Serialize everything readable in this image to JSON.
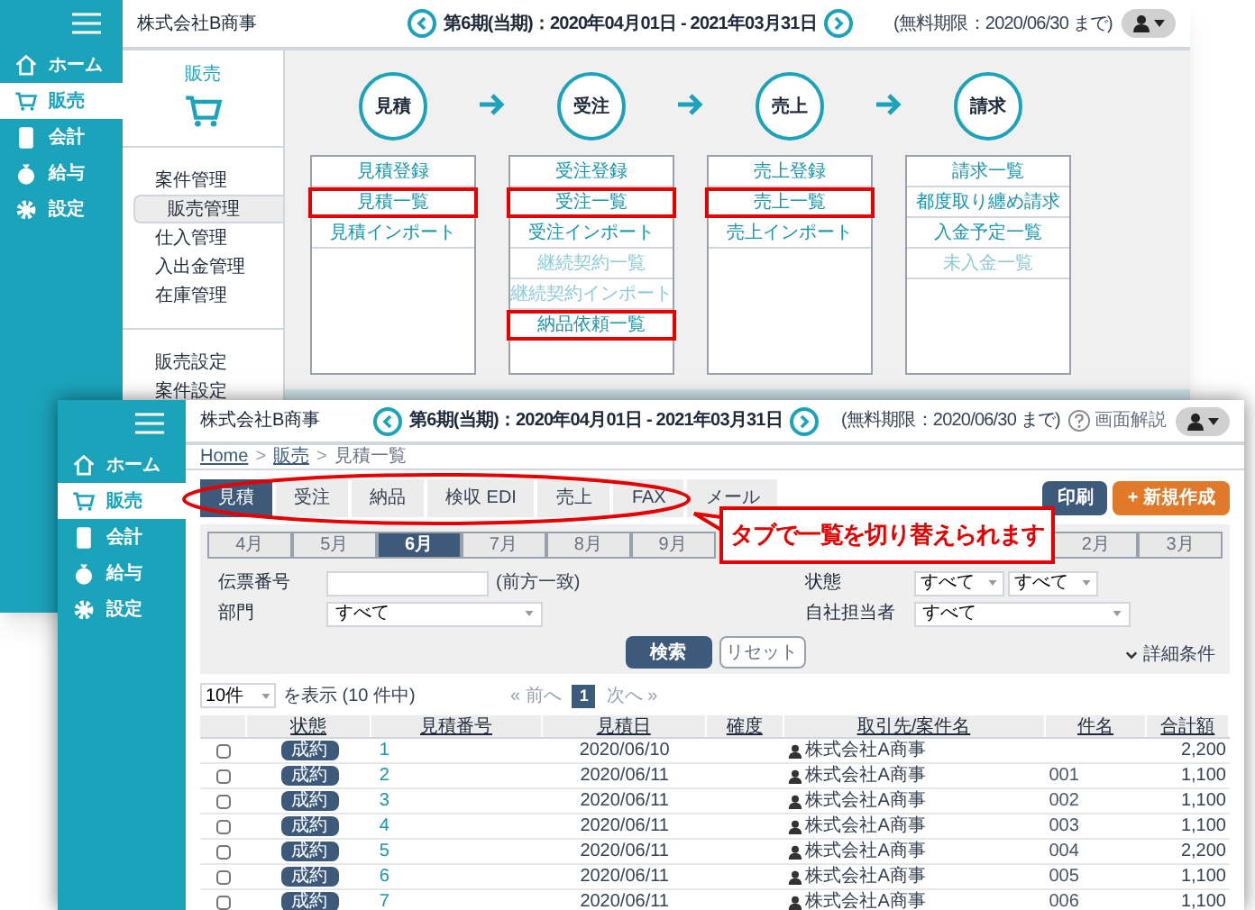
{
  "back_window": {
    "sidebar": {
      "items": [
        {
          "label": "ホーム",
          "selected": false
        },
        {
          "label": "販売",
          "selected": true
        },
        {
          "label": "会計",
          "selected": false
        },
        {
          "label": "給与",
          "selected": false
        },
        {
          "label": "設定",
          "selected": false
        }
      ]
    },
    "header": {
      "company": "株式会社B商事",
      "period": "第6期(当期)：2020年04月01日 - 2021年03月31日",
      "trial": "(無料期限：2020/06/30 まで)"
    },
    "submenu": {
      "title": "販売",
      "groups": [
        [
          {
            "label": "案件管理",
            "selected": false
          },
          {
            "label": "販売管理",
            "selected": true
          },
          {
            "label": "仕入管理",
            "selected": false
          },
          {
            "label": "入出金管理",
            "selected": false
          },
          {
            "label": "在庫管理",
            "selected": false
          }
        ],
        [
          {
            "label": "販売設定",
            "selected": false
          },
          {
            "label": "案件設定",
            "selected": false
          }
        ]
      ]
    },
    "flow": [
      {
        "step": "見積",
        "links": [
          {
            "label": "見積登録",
            "highlighted": false,
            "disabled": false
          },
          {
            "label": "見積一覧",
            "highlighted": true,
            "disabled": false
          },
          {
            "label": "見積インポート",
            "highlighted": false,
            "disabled": false
          }
        ]
      },
      {
        "step": "受注",
        "links": [
          {
            "label": "受注登録",
            "highlighted": false,
            "disabled": false
          },
          {
            "label": "受注一覧",
            "highlighted": true,
            "disabled": false
          },
          {
            "label": "受注インポート",
            "highlighted": false,
            "disabled": false
          },
          {
            "label": "継続契約一覧",
            "highlighted": false,
            "disabled": true
          },
          {
            "label": "継続契約インポート",
            "highlighted": false,
            "disabled": true
          },
          {
            "label": "納品依頼一覧",
            "highlighted": true,
            "disabled": false
          }
        ]
      },
      {
        "step": "売上",
        "links": [
          {
            "label": "売上登録",
            "highlighted": false,
            "disabled": false
          },
          {
            "label": "売上一覧",
            "highlighted": true,
            "disabled": false
          },
          {
            "label": "売上インポート",
            "highlighted": false,
            "disabled": false
          }
        ]
      },
      {
        "step": "請求",
        "links": [
          {
            "label": "請求一覧",
            "highlighted": false,
            "disabled": false
          },
          {
            "label": "都度取り纏め請求",
            "highlighted": false,
            "disabled": false
          },
          {
            "label": "入金予定一覧",
            "highlighted": false,
            "disabled": false
          },
          {
            "label": "未入金一覧",
            "highlighted": false,
            "disabled": true
          }
        ]
      }
    ]
  },
  "front_window": {
    "sidebar": {
      "items": [
        {
          "label": "ホーム",
          "selected": false
        },
        {
          "label": "販売",
          "selected": true
        },
        {
          "label": "会計",
          "selected": false
        },
        {
          "label": "給与",
          "selected": false
        },
        {
          "label": "設定",
          "selected": false
        }
      ]
    },
    "header": {
      "company": "株式会社B商事",
      "period": "第6期(当期)：2020年04月01日 - 2021年03月31日",
      "trial": "(無料期限：2020/06/30 まで)",
      "help": "画面解説"
    },
    "breadcrumb": {
      "separator": ">",
      "items": [
        {
          "label": "Home",
          "kind": "link"
        },
        {
          "label": "販売",
          "kind": "link"
        },
        {
          "label": "見積一覧",
          "kind": "current"
        }
      ]
    },
    "tabs": [
      {
        "label": "見積",
        "selected": true
      },
      {
        "label": "受注",
        "selected": false
      },
      {
        "label": "納品",
        "selected": false
      },
      {
        "label": "検収 EDI",
        "selected": false
      },
      {
        "label": "売上",
        "selected": false
      },
      {
        "label": "FAX",
        "selected": false
      },
      {
        "label": "メール",
        "selected": false
      }
    ],
    "actions": [
      {
        "label": "印刷",
        "kind": "print"
      },
      {
        "label": "+ 新規作成",
        "kind": "create"
      }
    ],
    "months": [
      {
        "kind": "month",
        "label": "4月",
        "selected": false
      },
      {
        "kind": "month",
        "label": "5月",
        "selected": false
      },
      {
        "kind": "month",
        "label": "6月",
        "selected": true
      },
      {
        "kind": "month",
        "label": "7月",
        "selected": false
      },
      {
        "kind": "month",
        "label": "8月",
        "selected": false
      },
      {
        "kind": "month",
        "label": "9月",
        "selected": false
      },
      {
        "kind": "covered"
      },
      {
        "kind": "covered"
      },
      {
        "kind": "covered"
      },
      {
        "kind": "covered"
      },
      {
        "kind": "month",
        "label": "2月",
        "selected": false
      },
      {
        "kind": "month",
        "label": "3月",
        "selected": false
      }
    ],
    "filters": [
      {
        "label": "伝票番号",
        "kind": "text",
        "note": "(前方一致)"
      },
      {
        "label": "状態",
        "kind": "select2",
        "values": [
          "すべて",
          "すべて"
        ]
      },
      {
        "label": "部門",
        "kind": "select",
        "value": "すべて"
      },
      {
        "label": "自社担当者",
        "kind": "select",
        "value": "すべて"
      }
    ],
    "search_buttons": [
      {
        "label": "検索",
        "kind": "primary"
      },
      {
        "label": "リセット",
        "kind": "secondary"
      }
    ],
    "detail_toggle": "詳細条件",
    "pagination": {
      "page_size": "10件",
      "summary": "を表示 (10 件中)",
      "prev": "« 前へ",
      "pages": [
        {
          "label": "1",
          "selected": true
        }
      ],
      "next": "次へ »"
    },
    "table": {
      "columns": [
        "状態",
        "見積番号",
        "見積日",
        "確度",
        "取引先/案件名",
        "件名",
        "合計額"
      ],
      "rows": [
        {
          "checked": false,
          "status": "成約",
          "number": "1",
          "date": "2020/06/10",
          "client": "株式会社A商事",
          "total": "2,200"
        },
        {
          "checked": false,
          "status": "成約",
          "number": "2",
          "date": "2020/06/11",
          "client": "株式会社A商事",
          "subject": "001",
          "total": "1,100"
        },
        {
          "checked": false,
          "status": "成約",
          "number": "3",
          "date": "2020/06/11",
          "client": "株式会社A商事",
          "subject": "002",
          "total": "1,100"
        },
        {
          "checked": false,
          "status": "成約",
          "number": "4",
          "date": "2020/06/11",
          "client": "株式会社A商事",
          "subject": "003",
          "total": "1,100"
        },
        {
          "checked": false,
          "status": "成約",
          "number": "5",
          "date": "2020/06/11",
          "client": "株式会社A商事",
          "subject": "004",
          "total": "2,200"
        },
        {
          "checked": false,
          "status": "成約",
          "number": "6",
          "date": "2020/06/11",
          "client": "株式会社A商事",
          "subject": "005",
          "total": "1,100"
        },
        {
          "checked": false,
          "status": "成約",
          "number": "7",
          "date": "2020/06/11",
          "client": "株式会社A商事",
          "subject": "006",
          "total": "1,100"
        }
      ]
    }
  },
  "callout": {
    "text": "タブで一覧を切り替えられます"
  }
}
